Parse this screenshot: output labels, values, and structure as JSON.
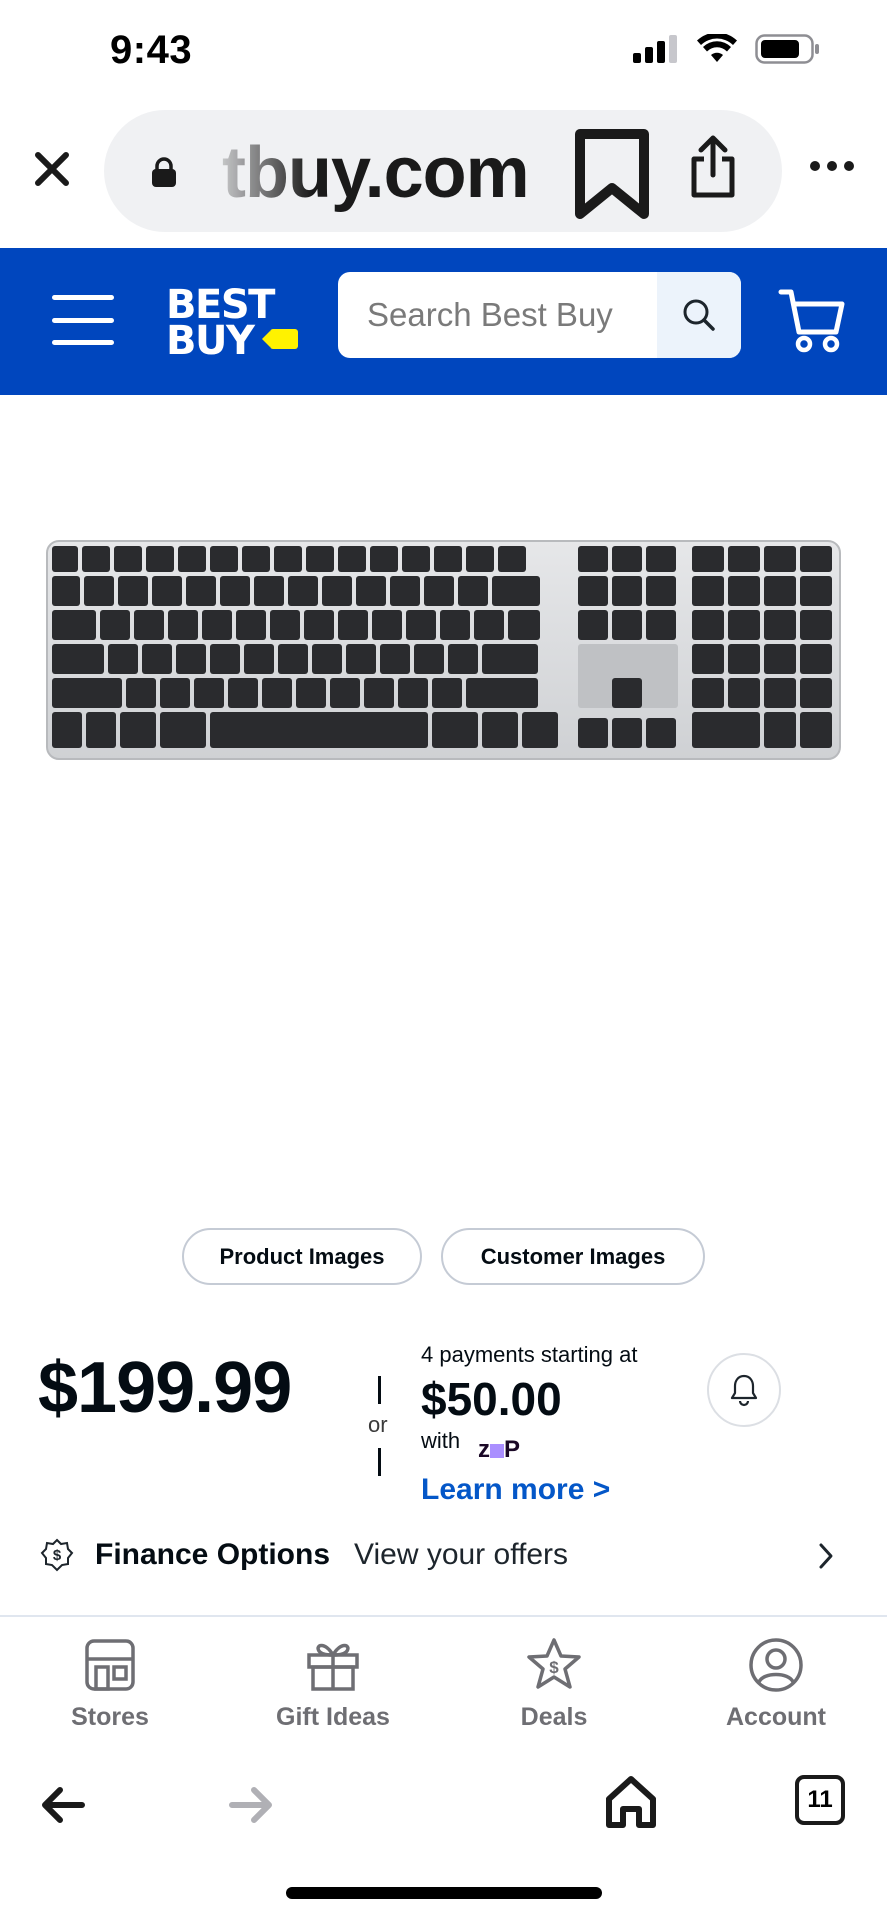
{
  "status_bar": {
    "time": "9:43",
    "icons": [
      "signal-icon",
      "wifi-icon",
      "battery-icon"
    ]
  },
  "browser": {
    "url": "tbuy.com",
    "close_icon": "close-icon",
    "lock_icon": "lock-icon",
    "bookmark_icon": "bookmark-icon",
    "share_icon": "share-icon",
    "more_icon": "more-icon"
  },
  "header": {
    "brand_line1": "BEST",
    "brand_line2": "BUY",
    "search": {
      "placeholder": "Search Best Buy"
    },
    "colors": {
      "brand_blue": "#0046be",
      "brand_yellow": "#fff200"
    }
  },
  "product": {
    "image_icon": "keyboard-image",
    "image_buttons": [
      "Product Images",
      "Customer Images"
    ]
  },
  "pricing": {
    "price": "$199.99",
    "or_text": "or",
    "payments_line": "4 payments starting at",
    "payment_amount": "$50.00",
    "with_text": "with",
    "provider_logo": "zip",
    "learn_more": "Learn more >",
    "link_color": "#0457c8"
  },
  "finance": {
    "title": "Finance Options",
    "subtitle": "View your offers"
  },
  "bottom_nav": {
    "items": [
      {
        "label": "Stores",
        "icon": "store-icon"
      },
      {
        "label": "Gift Ideas",
        "icon": "gift-icon"
      },
      {
        "label": "Deals",
        "icon": "deals-icon"
      },
      {
        "label": "Account",
        "icon": "account-icon"
      }
    ]
  },
  "safari_toolbar": {
    "tab_count": "11"
  }
}
